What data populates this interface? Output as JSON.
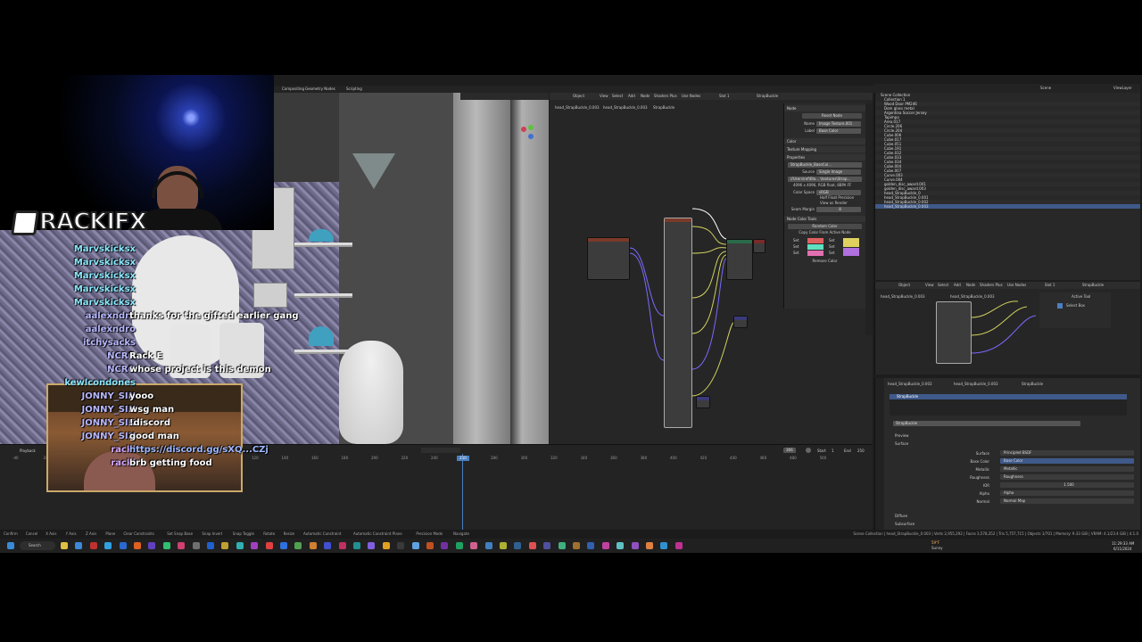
{
  "viewport": {
    "tabs": [
      "Compositing",
      "Geometry Nodes",
      "Scripting"
    ]
  },
  "node_editor": {
    "menu": [
      "Object",
      "View",
      "Select",
      "Add",
      "Node",
      "Shaders Plus",
      "Use Nodes",
      "Slot 1",
      "StrapBuckle"
    ],
    "breadcrumb": [
      "head_StrapBuckle_0.003",
      "head_StrapBuckle_0.003",
      "StrapBuckle"
    ],
    "panel": {
      "node_label": "Node",
      "reset_node": "Reset Node",
      "name_label": "Name",
      "name_value": "Image Texture.001",
      "label_label": "Label",
      "label_value": "Base Color",
      "color_section": "Color",
      "texture_mapping": "Texture Mapping",
      "properties": "Properties",
      "image_name": "StrapBuckle_BaseCol...",
      "source_label": "Source",
      "source_value": "Single Image",
      "filepath": "//Users\\ref\\Bla... \\textures\\Strap...",
      "info": "4096 x 4096, RGB float, 8BPA FF",
      "color_space_label": "Color Space",
      "color_space_value": "sRGB",
      "half_float": "Half Float Precision",
      "view_render": "View as Render",
      "seam_margin_label": "Seam Margin",
      "seam_margin_value": "8",
      "color_tools": "Node Color Tools",
      "random_color": "Random Color",
      "copy_color": "Copy Color From Active Node",
      "remove_color": "Remove Color",
      "swatch_labels": [
        "Set",
        "Set",
        "Set",
        "Set",
        "Set",
        "Set"
      ]
    }
  },
  "outliner": {
    "header": "Scene",
    "header2": "ViewLayer",
    "root": "Scene Collection",
    "items": [
      "Collection 1",
      "Wood Door PM246",
      "Dom glass metal",
      "Argentina Soccer Jersey",
      "Tapimpo",
      "Area.017",
      "Circle.206",
      "Circle.204",
      "Cube.006",
      "Cube.017",
      "Cube.051",
      "Cube.191",
      "Cube.032",
      "Cube.033",
      "Cube.034",
      "Cube.004",
      "Cube.007",
      "Curve.003",
      "Curve.004",
      "golden_disc_award.001",
      "golden_disc_award.003",
      "head_StrapBuckle_0",
      "head_StrapBuckle_0.001",
      "head_StrapBuckle_0.002",
      "head_StrapBuckle_0.003"
    ]
  },
  "mini_node": {
    "menu": [
      "Object",
      "View",
      "Select",
      "Add",
      "Node",
      "Shaders Plus",
      "Use Nodes",
      "Slot 1",
      "StrapBuckle"
    ],
    "breadcrumb": [
      "head_StrapBuckle_0.003",
      "head_StrapBuckle_0.003"
    ],
    "active_tool": "Active Tool",
    "select_box": "Select Box"
  },
  "props": {
    "breadcrumb": [
      "head_StrapBuckle_0.003",
      "head_StrapBuckle_0.003",
      "StrapBuckle"
    ],
    "material_slot": "StrapBuckle",
    "material_name": "StrapBuckle",
    "preview": "Preview",
    "surface_section": "Surface",
    "rows": [
      {
        "label": "Surface",
        "value": "Principled BSDF"
      },
      {
        "label": "Base Color",
        "value": "Base Color"
      },
      {
        "label": "Metallic",
        "value": "Metallic"
      },
      {
        "label": "Roughness",
        "value": "Roughness"
      },
      {
        "label": "IOR",
        "value": "1.500"
      },
      {
        "label": "Alpha",
        "value": "Alpha"
      },
      {
        "label": "Normal",
        "value": "Normal Map"
      }
    ],
    "diffuse": "Diffuse",
    "subsurface": "Subsurface"
  },
  "timeline": {
    "playback": "Playback",
    "current_frame": "210",
    "start_label": "Start",
    "start_value": "1",
    "end_label": "End",
    "end_value": "250",
    "frame_field": "366",
    "ticks": [
      "-40",
      "-20",
      "0",
      "20",
      "40",
      "60",
      "80",
      "100",
      "120",
      "140",
      "160",
      "180",
      "200",
      "220",
      "240",
      "260",
      "280",
      "300",
      "320",
      "340",
      "360",
      "380",
      "400",
      "420",
      "440",
      "460",
      "480",
      "500"
    ]
  },
  "statusbar": {
    "left": [
      "Confirm",
      "Cancel",
      "X Axis",
      "Y Axis",
      "Z Axis",
      "Plane",
      "Clear Constraints",
      "Set Snap Base",
      "Snap Invert",
      "Snap Toggle",
      "Rotate",
      "Resize",
      "Automatic Constraint",
      "Automatic Constraint Plane",
      "Precision Mode",
      "Navigate"
    ],
    "right": "Scene Collection | head_StrapBuckle_0.003 | Verts 2,955,292 | Faces 3,578,352 | Tris 5,757,715 | Objects 1/701 | Memory: 9.33 GiB | VRAM: 4.1/23.4 GiB | 4.1.0"
  },
  "taskbar": {
    "search": "Search",
    "weather_temp": "59°F",
    "weather_desc": "Sunny",
    "time": "11:29:33 AM",
    "date": "6/11/2024"
  },
  "overlay": {
    "logo_text": "RACKIFX",
    "chat": [
      {
        "name": "Marvskicksx",
        "msg": "",
        "color": "#8be8ff"
      },
      {
        "name": "Marvskicksx",
        "msg": "",
        "color": "#8be8ff"
      },
      {
        "name": "Marvskicksx",
        "msg": "",
        "color": "#8be8ff"
      },
      {
        "name": "Marvskicksx",
        "msg": "",
        "color": "#8be8ff"
      },
      {
        "name": "Marvskicksx",
        "msg": "",
        "color": "#8be8ff"
      },
      {
        "name": "aalexndro",
        "msg": "thanks for the gifted earlier gang",
        "color": "#b8b8ff"
      },
      {
        "name": "aalexndro",
        "msg": "",
        "color": "#b8b8ff"
      },
      {
        "name": "itchysacks",
        "msg": "",
        "color": "#b8b8ff"
      },
      {
        "name": "NCRO",
        "msg": "Rack E",
        "color": "#b8b8ff"
      },
      {
        "name": "NCRO",
        "msg": "whose project is this demon",
        "color": "#b8b8ff"
      },
      {
        "name": "kewlcondones",
        "msg": "",
        "color": "#8be8ff"
      },
      {
        "name": "JONNY_SIN",
        "msg": "yooo",
        "color": "#b8b8ff"
      },
      {
        "name": "JONNY_SIN",
        "msg": "wsg man",
        "color": "#b8b8ff"
      },
      {
        "name": "JONNY_SIN",
        "msg": "!discord",
        "color": "#b8b8ff"
      },
      {
        "name": "JONNY_SIN",
        "msg": "good man",
        "color": "#b8b8ff"
      },
      {
        "name": "racki",
        "msg": "https://discord.gg/sXQ...CZj",
        "color": "#d6a8ff"
      },
      {
        "name": "racki",
        "msg": "brb getting food",
        "color": "#d6a8ff"
      }
    ]
  },
  "colors": {
    "accent": "#4a7fc1",
    "selection": "#3f5a8a",
    "node_header": "#7a3a2a",
    "playhead": "#4a7fc1"
  }
}
